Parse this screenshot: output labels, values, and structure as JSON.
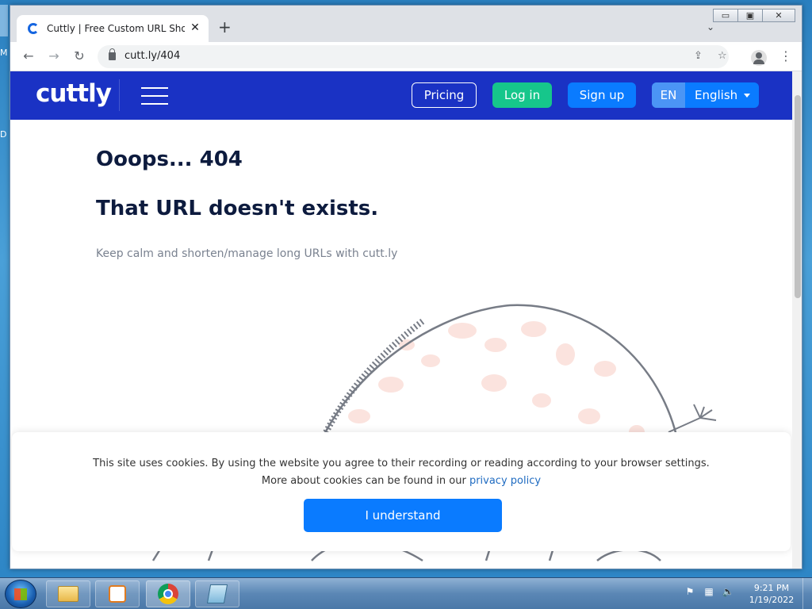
{
  "browser": {
    "tab_title": "Cuttly | Free Custom URL Shortener",
    "new_tab_glyph": "+",
    "close_glyph": "✕",
    "url": "cutt.ly/404",
    "back_glyph": "←",
    "forward_glyph": "→",
    "reload_glyph": "↻",
    "share_glyph": "⇪",
    "star_glyph": "☆",
    "menu_glyph": "⋮",
    "tab_search_glyph": "⌄",
    "window_controls": {
      "minimize": "▭",
      "maximize": "▣",
      "close": "✕"
    }
  },
  "site": {
    "logo": "cuttly",
    "nav": {
      "pricing": "Pricing",
      "login": "Log in",
      "signup": "Sign up",
      "lang_code": "EN",
      "lang_name": "English"
    },
    "heading": "Ooops... 404",
    "subheading": "That URL doesn't exists.",
    "tagline": "Keep calm and shorten/manage long URLs with cutt.ly"
  },
  "cookie": {
    "line1": "This site uses cookies. By using the website you agree to their recording or reading according to your browser settings.",
    "line2_prefix": "More about cookies can be found in our ",
    "link": "privacy policy",
    "button": "I understand"
  },
  "taskbar": {
    "time": "9:21 PM",
    "date": "1/19/2022"
  },
  "desktop": {
    "fragment_top": "M",
    "fragment_mid": "D"
  },
  "colors": {
    "header_blue": "#1a32c4",
    "login_green": "#16c68b",
    "signup_blue": "#0a7bff",
    "heading_navy": "#0d1b3e"
  }
}
